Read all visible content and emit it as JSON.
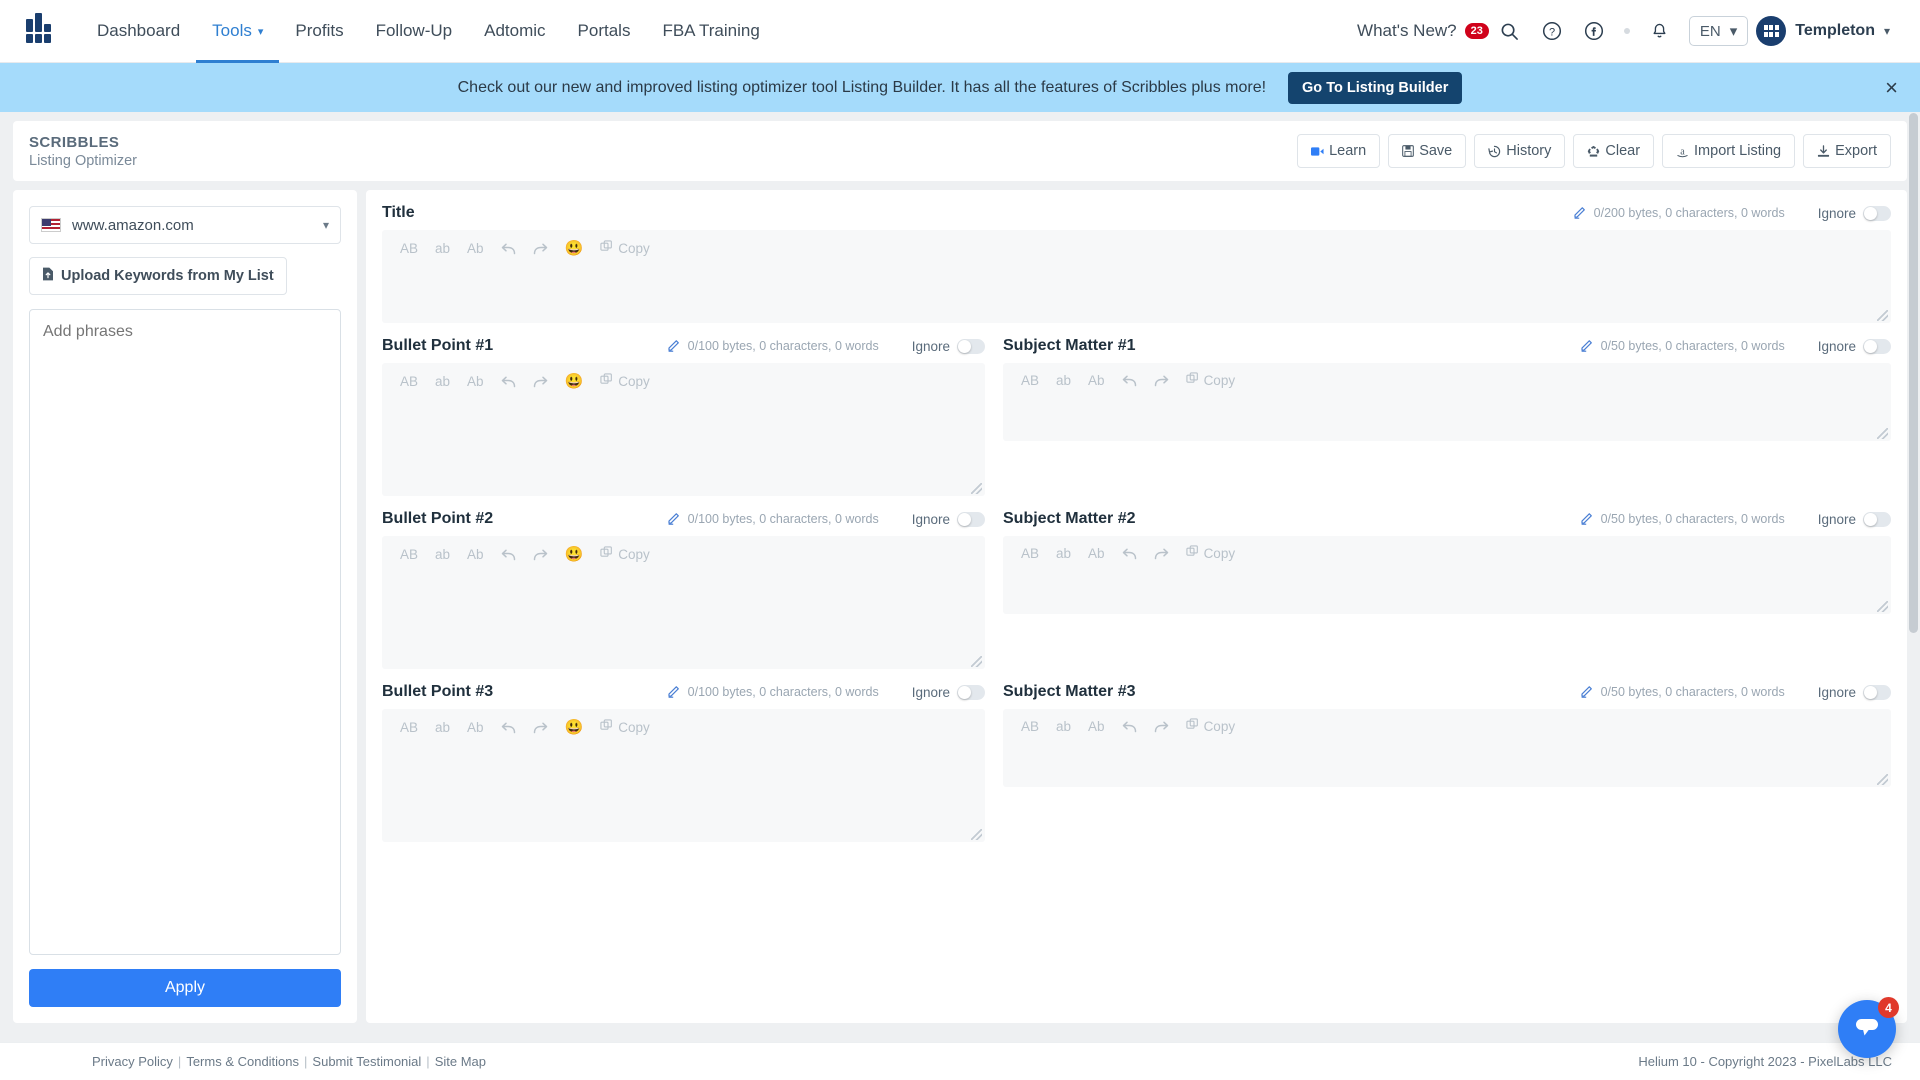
{
  "topnav": {
    "logo_icon": "helium10-bars-logo-icon",
    "links": [
      {
        "label": "Dashboard",
        "active": false
      },
      {
        "label": "Tools",
        "active": true,
        "caret": "⌄"
      },
      {
        "label": "Profits",
        "active": false
      },
      {
        "label": "Follow-Up",
        "active": false
      },
      {
        "label": "Adtomic",
        "active": false
      },
      {
        "label": "Portals",
        "active": false
      },
      {
        "label": "FBA Training",
        "active": false
      }
    ],
    "whats_new_label": "What's New?",
    "whats_new_count": "23",
    "search_icon": "search-icon",
    "help_icon": "question-circle-icon",
    "facebook_icon": "facebook-icon",
    "bell_icon": "bell-icon",
    "language": "EN",
    "user_name": "Templeton"
  },
  "banner": {
    "text": "Check out our new and improved listing optimizer tool Listing Builder. It has all the features of Scribbles plus more!",
    "button_label": "Go To Listing Builder",
    "close_icon": "close-icon"
  },
  "page_header": {
    "title": "SCRIBBLES",
    "subtitle": "Listing Optimizer",
    "actions": [
      {
        "label": "Learn",
        "icon": "video-icon"
      },
      {
        "label": "Save",
        "icon": "save-disk-icon"
      },
      {
        "label": "History",
        "icon": "history-clock-icon"
      },
      {
        "label": "Clear",
        "icon": "recycle-icon"
      },
      {
        "label": "Import Listing",
        "icon": "amazon-a-icon"
      },
      {
        "label": "Export",
        "icon": "download-icon"
      }
    ]
  },
  "sidebar": {
    "marketplace": "www.amazon.com",
    "marketplace_flag": "us-flag-icon",
    "upload_label": "Upload Keywords from My List",
    "upload_icon": "file-upload-icon",
    "phrases_placeholder": "Add phrases",
    "phrases_value": "",
    "apply_label": "Apply"
  },
  "editor_toolbar": {
    "tools": [
      "AB",
      "ab",
      "Ab"
    ],
    "undo_icon": "undo-arrow-icon",
    "redo_icon": "redo-arrow-icon",
    "emoji_icon": "smiley-emoji-icon",
    "copy_label": "Copy",
    "copy_icon": "copy-icon"
  },
  "sections": {
    "title": {
      "label": "Title",
      "meta": "0/200 bytes, 0 characters, 0 words",
      "ignore_label": "Ignore",
      "value": "",
      "has_emoji": true
    },
    "bullets": [
      {
        "label": "Bullet Point #1",
        "meta": "0/100 bytes, 0 characters, 0 words",
        "ignore_label": "Ignore",
        "value": "",
        "has_emoji": true
      },
      {
        "label": "Bullet Point #2",
        "meta": "0/100 bytes, 0 characters, 0 words",
        "ignore_label": "Ignore",
        "value": "",
        "has_emoji": true
      },
      {
        "label": "Bullet Point #3",
        "meta": "0/100 bytes, 0 characters, 0 words",
        "ignore_label": "Ignore",
        "value": "",
        "has_emoji": true
      }
    ],
    "subjects": [
      {
        "label": "Subject Matter #1",
        "meta": "0/50 bytes, 0 characters, 0 words",
        "ignore_label": "Ignore",
        "value": "",
        "has_emoji": false
      },
      {
        "label": "Subject Matter #2",
        "meta": "0/50 bytes, 0 characters, 0 words",
        "ignore_label": "Ignore",
        "value": "",
        "has_emoji": false
      },
      {
        "label": "Subject Matter #3",
        "meta": "0/50 bytes, 0 characters, 0 words",
        "ignore_label": "Ignore",
        "value": "",
        "has_emoji": false
      }
    ]
  },
  "footer": {
    "links": [
      "Privacy Policy",
      "Terms & Conditions",
      "Submit Testimonial",
      "Site Map"
    ],
    "copyright": "Helium 10 - Copyright 2023 - PixelLabs LLC"
  },
  "chat": {
    "badge": "4",
    "icon": "chat-bubble-icon"
  },
  "colors": {
    "accent": "#2f7ef6",
    "nav_active": "#2f7fd1",
    "banner_bg": "#a5dbfb",
    "banner_btn": "#14446e",
    "badge_red": "#d0021b"
  }
}
